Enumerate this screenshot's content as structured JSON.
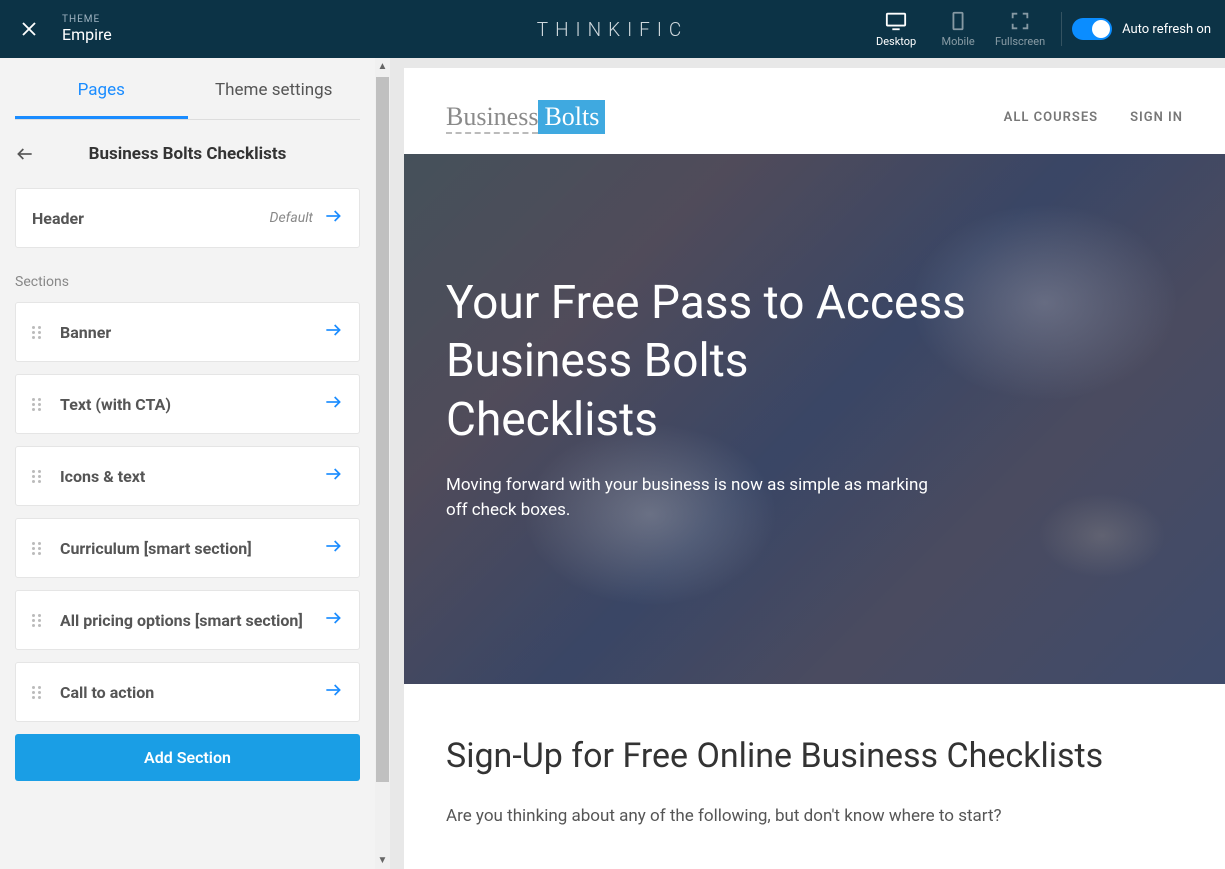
{
  "topbar": {
    "theme_label": "THEME",
    "theme_name": "Empire",
    "brand": "THINKIFIC",
    "devices": [
      {
        "label": "Desktop",
        "active": true
      },
      {
        "label": "Mobile",
        "active": false
      },
      {
        "label": "Fullscreen",
        "active": false
      }
    ],
    "auto_refresh": "Auto refresh on"
  },
  "sidebar": {
    "tabs": [
      {
        "label": "Pages",
        "active": true
      },
      {
        "label": "Theme settings",
        "active": false
      }
    ],
    "page_title": "Business Bolts Checklists",
    "header_card": {
      "label": "Header",
      "badge": "Default"
    },
    "sections_label": "Sections",
    "sections": [
      {
        "label": "Banner"
      },
      {
        "label": "Text (with CTA)"
      },
      {
        "label": "Icons & text"
      },
      {
        "label": "Curriculum [smart section]"
      },
      {
        "label": "All pricing options [smart section]"
      },
      {
        "label": "Call to action"
      }
    ],
    "add_section": "Add Section"
  },
  "preview": {
    "logo": {
      "part1": "Business",
      "part2": "Bolts"
    },
    "nav": [
      {
        "label": "ALL COURSES"
      },
      {
        "label": "SIGN IN"
      }
    ],
    "banner": {
      "heading": "Your Free Pass to Access Business Bolts Checklists",
      "subtext": "Moving forward with your business is now as simple as marking off check boxes."
    },
    "signup": {
      "heading": "Sign-Up for Free Online Business Checklists",
      "body": "Are you thinking about any of the following, but don't know where to start?"
    }
  }
}
